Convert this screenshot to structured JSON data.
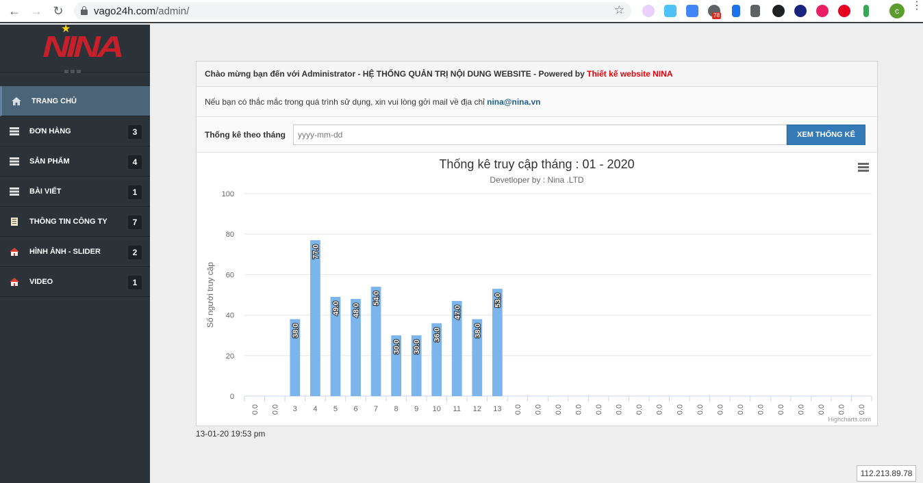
{
  "browser": {
    "url_host": "vago24h.com",
    "url_path": "/admin/",
    "ext_badge": "78",
    "profile_initial": "c"
  },
  "sidebar": {
    "logo_text": "NINA",
    "items": [
      {
        "label": "TRANG CHỦ",
        "badge": "",
        "icon": "home-icon"
      },
      {
        "label": "ĐƠN HÀNG",
        "badge": "3",
        "icon": "list-icon"
      },
      {
        "label": "SẢN PHẨM",
        "badge": "4",
        "icon": "list-icon"
      },
      {
        "label": "BÀI VIẾT",
        "badge": "1",
        "icon": "list-icon"
      },
      {
        "label": "THÔNG TIN CÔNG TY",
        "badge": "7",
        "icon": "document-icon"
      },
      {
        "label": "HÌNH ẢNH - SLIDER",
        "badge": "2",
        "icon": "house-image-icon"
      },
      {
        "label": "VIDEO",
        "badge": "1",
        "icon": "house-image-icon"
      }
    ]
  },
  "panel": {
    "header_text": "Chào mừng bạn đến với Administrator - HỆ THỐNG QUẢN TRỊ NỘI DUNG WEBSITE - Powered by ",
    "header_brand": "Thiết kế website NINA",
    "info_text": "Nếu bạn có thắc mắc trong quá trình sử dụng, xin vui lòng gởi mail về địa chỉ ",
    "info_email": "nina@nina.vn",
    "filter_label": "Thống kê theo tháng",
    "filter_placeholder": "yyyy-mm-dd",
    "filter_button": "XEM THỐNG KÊ"
  },
  "chart_data": {
    "type": "bar",
    "title": "Thống kê truy cập tháng : 01 - 2020",
    "subtitle": "Devetloper by : Nina .LTD",
    "ylabel": "Số người truy cập",
    "xlabel": "",
    "ylim": [
      0,
      100
    ],
    "yticks": [
      0,
      20,
      40,
      60,
      80,
      100
    ],
    "grid": true,
    "categories": [
      "0.0",
      "0.0",
      "3",
      "4",
      "5",
      "6",
      "7",
      "8",
      "9",
      "10",
      "11",
      "12",
      "13",
      "0.0",
      "0.0",
      "0.0",
      "0.0",
      "0.0",
      "0.0",
      "0.0",
      "0.0",
      "0.0",
      "0.0",
      "0.0",
      "0.0",
      "0.0",
      "0.0",
      "0.0",
      "0.0",
      "0.0",
      "0.0"
    ],
    "values": [
      0,
      0,
      38,
      77,
      49,
      48,
      54,
      30,
      30,
      36,
      47,
      38,
      53,
      0,
      0,
      0,
      0,
      0,
      0,
      0,
      0,
      0,
      0,
      0,
      0,
      0,
      0,
      0,
      0,
      0,
      0
    ],
    "data_labels": [
      "",
      "",
      "38.0",
      "77.0",
      "49.0",
      "48.0",
      "54.0",
      "30.0",
      "30.0",
      "36.0",
      "47.0",
      "38.0",
      "53.0",
      "",
      "",
      "",
      "",
      "",
      "",
      "",
      "",
      "",
      "",
      "",
      "",
      "",
      "",
      "",
      "",
      "",
      ""
    ],
    "bar_color": "#7cb5ec",
    "credits": "Highcharts.com"
  },
  "footer": {
    "timestamp": "13-01-20 19:53 pm",
    "ip": "112.213.89.78"
  }
}
